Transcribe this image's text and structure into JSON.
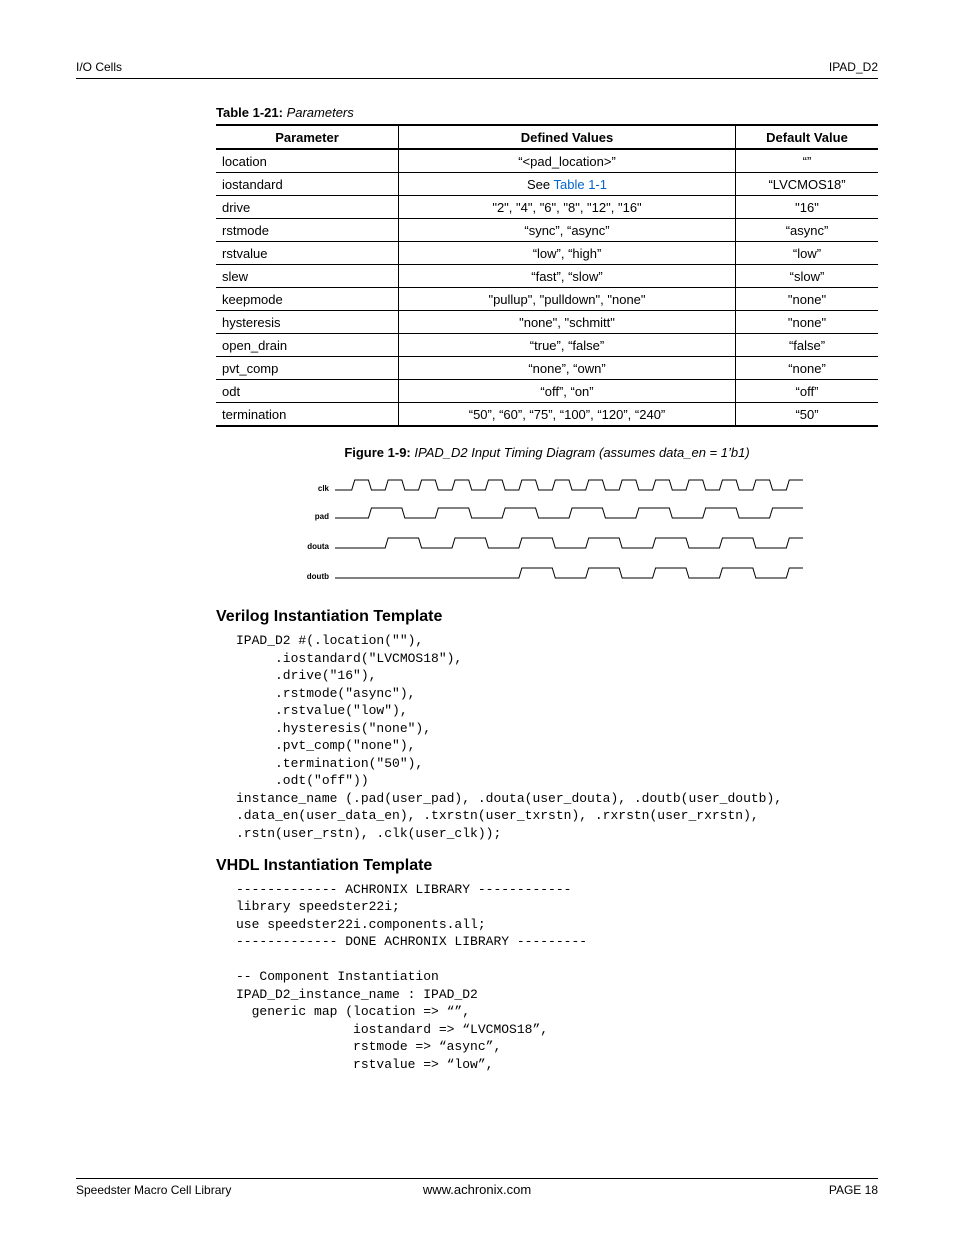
{
  "header": {
    "left": "I/O Cells",
    "right": "IPAD_D2"
  },
  "table": {
    "caption_bold": "Table 1-21:",
    "caption_ital": "  Parameters",
    "cols": [
      "Parameter",
      "Defined Values",
      "Default Value"
    ],
    "rows": [
      {
        "param": "location",
        "defined": "“<pad_location>”",
        "default": "“”"
      },
      {
        "param": "iostandard",
        "defined_prefix": "See ",
        "defined_link": "Table 1-1",
        "default": "“LVCMOS18”"
      },
      {
        "param": "drive",
        "defined": "\"2\", \"4\", \"6\", \"8\", \"12\", \"16\"",
        "default": "\"16\""
      },
      {
        "param": "rstmode",
        "defined": "“sync”, “async”",
        "default": "“async”"
      },
      {
        "param": "rstvalue",
        "defined": "“low”, “high”",
        "default": "“low”"
      },
      {
        "param": "slew",
        "defined": "“fast”, “slow”",
        "default": "“slow”"
      },
      {
        "param": "keepmode",
        "defined": "\"pullup\", \"pulldown\", \"none\"",
        "default": "\"none\""
      },
      {
        "param": "hysteresis",
        "defined": "\"none\", \"schmitt\"",
        "default": "\"none\""
      },
      {
        "param": "open_drain",
        "defined": "“true”, “false”",
        "default": "“false”"
      },
      {
        "param": "pvt_comp",
        "defined": "“none”, “own”",
        "default": "“none”"
      },
      {
        "param": "odt",
        "defined": "“off”, “on”",
        "default": "“off”"
      },
      {
        "param": "termination",
        "defined": "“50”, “60”, “75”, “100”, “120”, “240”",
        "default": "“50”"
      }
    ]
  },
  "figure": {
    "caption_bold": "Figure 1-9:",
    "caption_ital": "  IPAD_D2 Input Timing Diagram (assumes data_en = 1’b1)",
    "signals": [
      "clk",
      "pad",
      "douta",
      "doutb"
    ]
  },
  "verilog": {
    "heading": "Verilog Instantiation Template",
    "code": "IPAD_D2 #(.location(\"\"),\n     .iostandard(\"LVCMOS18\"),\n     .drive(\"16\"),\n     .rstmode(\"async\"),\n     .rstvalue(\"low\"),\n     .hysteresis(\"none\"),\n     .pvt_comp(\"none\"),\n     .termination(\"50\"),\n     .odt(\"off\"))\ninstance_name (.pad(user_pad), .douta(user_douta), .doutb(user_doutb),\n.data_en(user_data_en), .txrstn(user_txrstn), .rxrstn(user_rxrstn),\n.rstn(user_rstn), .clk(user_clk));"
  },
  "vhdl": {
    "heading": "VHDL Instantiation Template",
    "code": "------------- ACHRONIX LIBRARY ------------\nlibrary speedster22i;\nuse speedster22i.components.all;\n------------- DONE ACHRONIX LIBRARY ---------\n\n-- Component Instantiation\nIPAD_D2_instance_name : IPAD_D2\n  generic map (location => “”,\n               iostandard => “LVCMOS18”,\n               rstmode => “async”,\n               rstvalue => “low”,"
  },
  "footer": {
    "left": "Speedster Macro Cell Library",
    "center": "www.achronix.com",
    "right": "PAGE 18"
  }
}
